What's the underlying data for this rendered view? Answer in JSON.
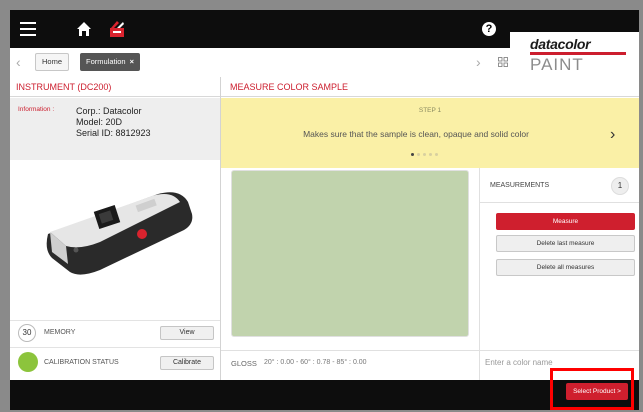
{
  "topbar": {
    "help_label": "?",
    "brand_top": "datacolor",
    "brand_bottom": "PAINT",
    "brand_color": "#cc1e2e"
  },
  "breadcrumbs": {
    "home": "Home",
    "current": "Formulation",
    "close": "×",
    "back_icon": "chevron-left-icon",
    "forward_icon": "chevron-right-icon",
    "grid_icon": "grid-icon"
  },
  "instrument": {
    "title": "INSTRUMENT (DC200)",
    "info_label": "Information :",
    "corp": "Corp.: Datacolor",
    "model": "Model: 20D",
    "serial": "Serial ID: 8812923",
    "memory_count": "30",
    "memory_label": "MEMORY",
    "view_label": "View",
    "calibration_label": "CALIBRATION STATUS",
    "calibration_color": "#8cc43c",
    "calibrate_label": "Calibrate"
  },
  "measure": {
    "title": "MEASURE COLOR SAMPLE",
    "step_label": "STEP 1",
    "step_text": "Makes sure that the sample is clean, opaque and solid color",
    "next_icon": "chevron-right-icon",
    "step_count": 5,
    "active_step": 1,
    "swatch_color": "#c1d3ad",
    "gloss_label": "GLOSS",
    "gloss_values": "20° : 0.00  -  60° : 0.78  -  85° : 0.00"
  },
  "measurements": {
    "title": "MEASUREMENTS",
    "count": "1",
    "measure_label": "Measure",
    "delete_last_label": "Delete last measure",
    "delete_all_label": "Delete all measures",
    "color_name_placeholder": "Enter a color name"
  },
  "footer": {
    "select_product_label": "Select Product >",
    "accent_color": "#cf1f2e"
  }
}
